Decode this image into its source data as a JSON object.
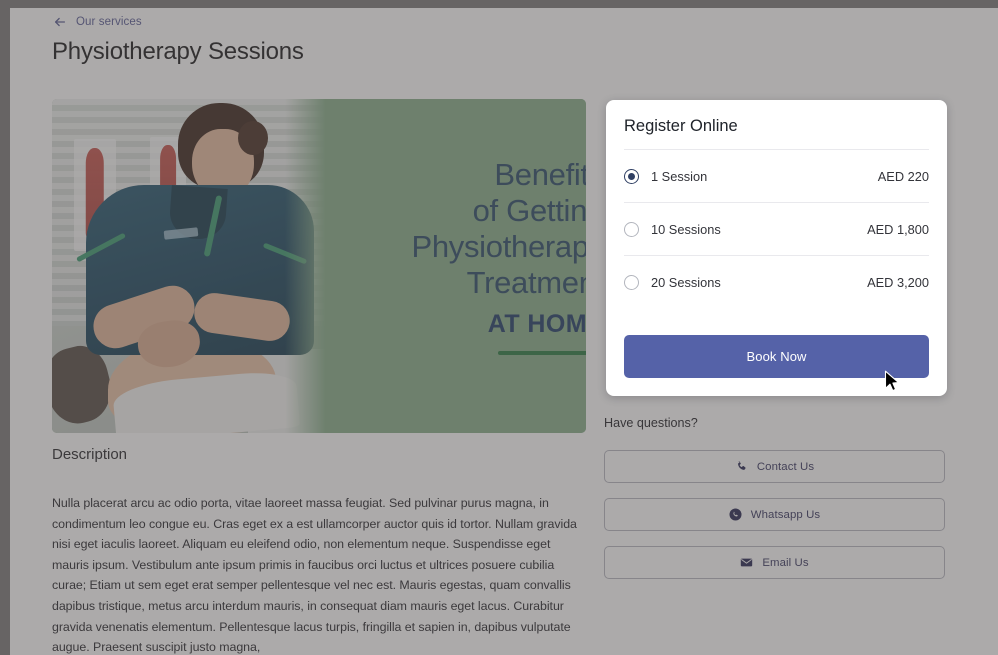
{
  "breadcrumb": {
    "back_icon": "arrow-left-icon",
    "label": "Our services"
  },
  "page": {
    "title": "Physiotherapy Sessions"
  },
  "hero": {
    "headline_line1": "Benefits",
    "headline_line2": "of Getting",
    "headline_line3": "Physiotherapy",
    "headline_line4": "Treatment",
    "headline_emphasis": "AT HOME",
    "photo_alt": "physiotherapist treating patient leg",
    "panel_color": "#8ab08d",
    "headline_color": "#2e4f6b",
    "rule_color": "#2f7d45"
  },
  "description": {
    "heading": "Description",
    "body": "Nulla placerat arcu ac odio porta, vitae laoreet massa feugiat. Sed pulvinar purus magna, in condimentum leo congue eu. Cras eget ex a est ullamcorper auctor quis id tortor. Nullam gravida nisi eget iaculis laoreet. Aliquam eu eleifend odio, non elementum neque. Suspendisse eget mauris ipsum. Vestibulum ante ipsum primis in faucibus orci luctus et ultrices posuere cubilia curae; Etiam ut sem eget erat semper pellentesque vel nec est. Mauris egestas, quam convallis dapibus tristique, metus arcu interdum mauris, in consequat diam mauris eget lacus. Curabitur gravida venenatis elementum. Pellentesque lacus turpis, fringilla et sapien in, dapibus vulputate augue. Praesent suscipit justo magna,"
  },
  "register": {
    "title": "Register Online",
    "selected_index": 0,
    "plans": [
      {
        "name": "1 Session",
        "price": "AED 220"
      },
      {
        "name": "10 Sessions",
        "price": "AED 1,800"
      },
      {
        "name": "20 Sessions",
        "price": "AED 3,200"
      }
    ],
    "book_label": "Book Now",
    "book_color": "#5562a8",
    "radio_color": "#2f3f63"
  },
  "help": {
    "label": "Have questions?",
    "buttons": [
      {
        "icon": "phone-icon",
        "label": "Contact Us"
      },
      {
        "icon": "whatsapp-icon",
        "label": "Whatsapp Us"
      },
      {
        "icon": "envelope-icon",
        "label": "Email Us"
      }
    ]
  },
  "overlay": {
    "scrim_color": "#4e4a4a"
  }
}
